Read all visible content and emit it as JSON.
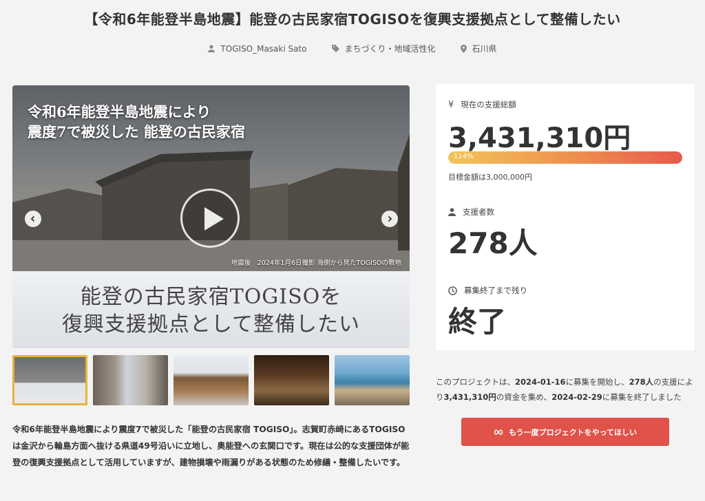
{
  "header": {
    "title": "【令和6年能登半島地震】能登の古民家宿TOGISOを復興支援拠点として整備したい",
    "owner": "TOGISO_Masaki Sato",
    "category": "まちづくり・地域活性化",
    "location": "石川県"
  },
  "hero": {
    "heading": "令和6年能登半島地震により\n震度7で被災した 能登の古民家宿",
    "caption": "地震後　2024年1月6日撮影 海側から見たTOGISOの敷地",
    "subheading": "能登の古民家宿TOGISOを\n復興支援拠点として整備したい"
  },
  "description": "令和6年能登半島地震により震度7で被災した「能登の古民家宿 TOGISO」。志賀町赤崎にあるTOGISOは金沢から輪島方面へ抜ける県道49号沿いに立地し、奥能登への玄関口です。現在は公的な支援団体が能登の復興支援拠点として活用していますが、建物損壊や雨漏りがある状態のため修繕・整備したいです。",
  "stats": {
    "amount_label": "現在の支援総額",
    "amount_value": "3,431,310円",
    "progress_label": "114%",
    "progress_fraction": 1.0,
    "goal_text": "目標金額は3,000,000円",
    "supporters_label": "支援者数",
    "supporters_value": "278人",
    "remaining_label": "募集終了まで残り",
    "remaining_value": "終了"
  },
  "summary": {
    "p1": "このプロジェクトは、",
    "start": "2024-01-16",
    "p2": "に募集を開始し、",
    "count": "278人",
    "p3": "の支援により",
    "amount": "3,431,310円",
    "p4": "の資金を集め、",
    "end": "2024-02-29",
    "p5": "に募集を終了しました"
  },
  "cta_label": "もう一度プロジェクトをやってほしい",
  "colors": {
    "accent": "#e0524a",
    "thumb_active": "#e8b33a"
  }
}
